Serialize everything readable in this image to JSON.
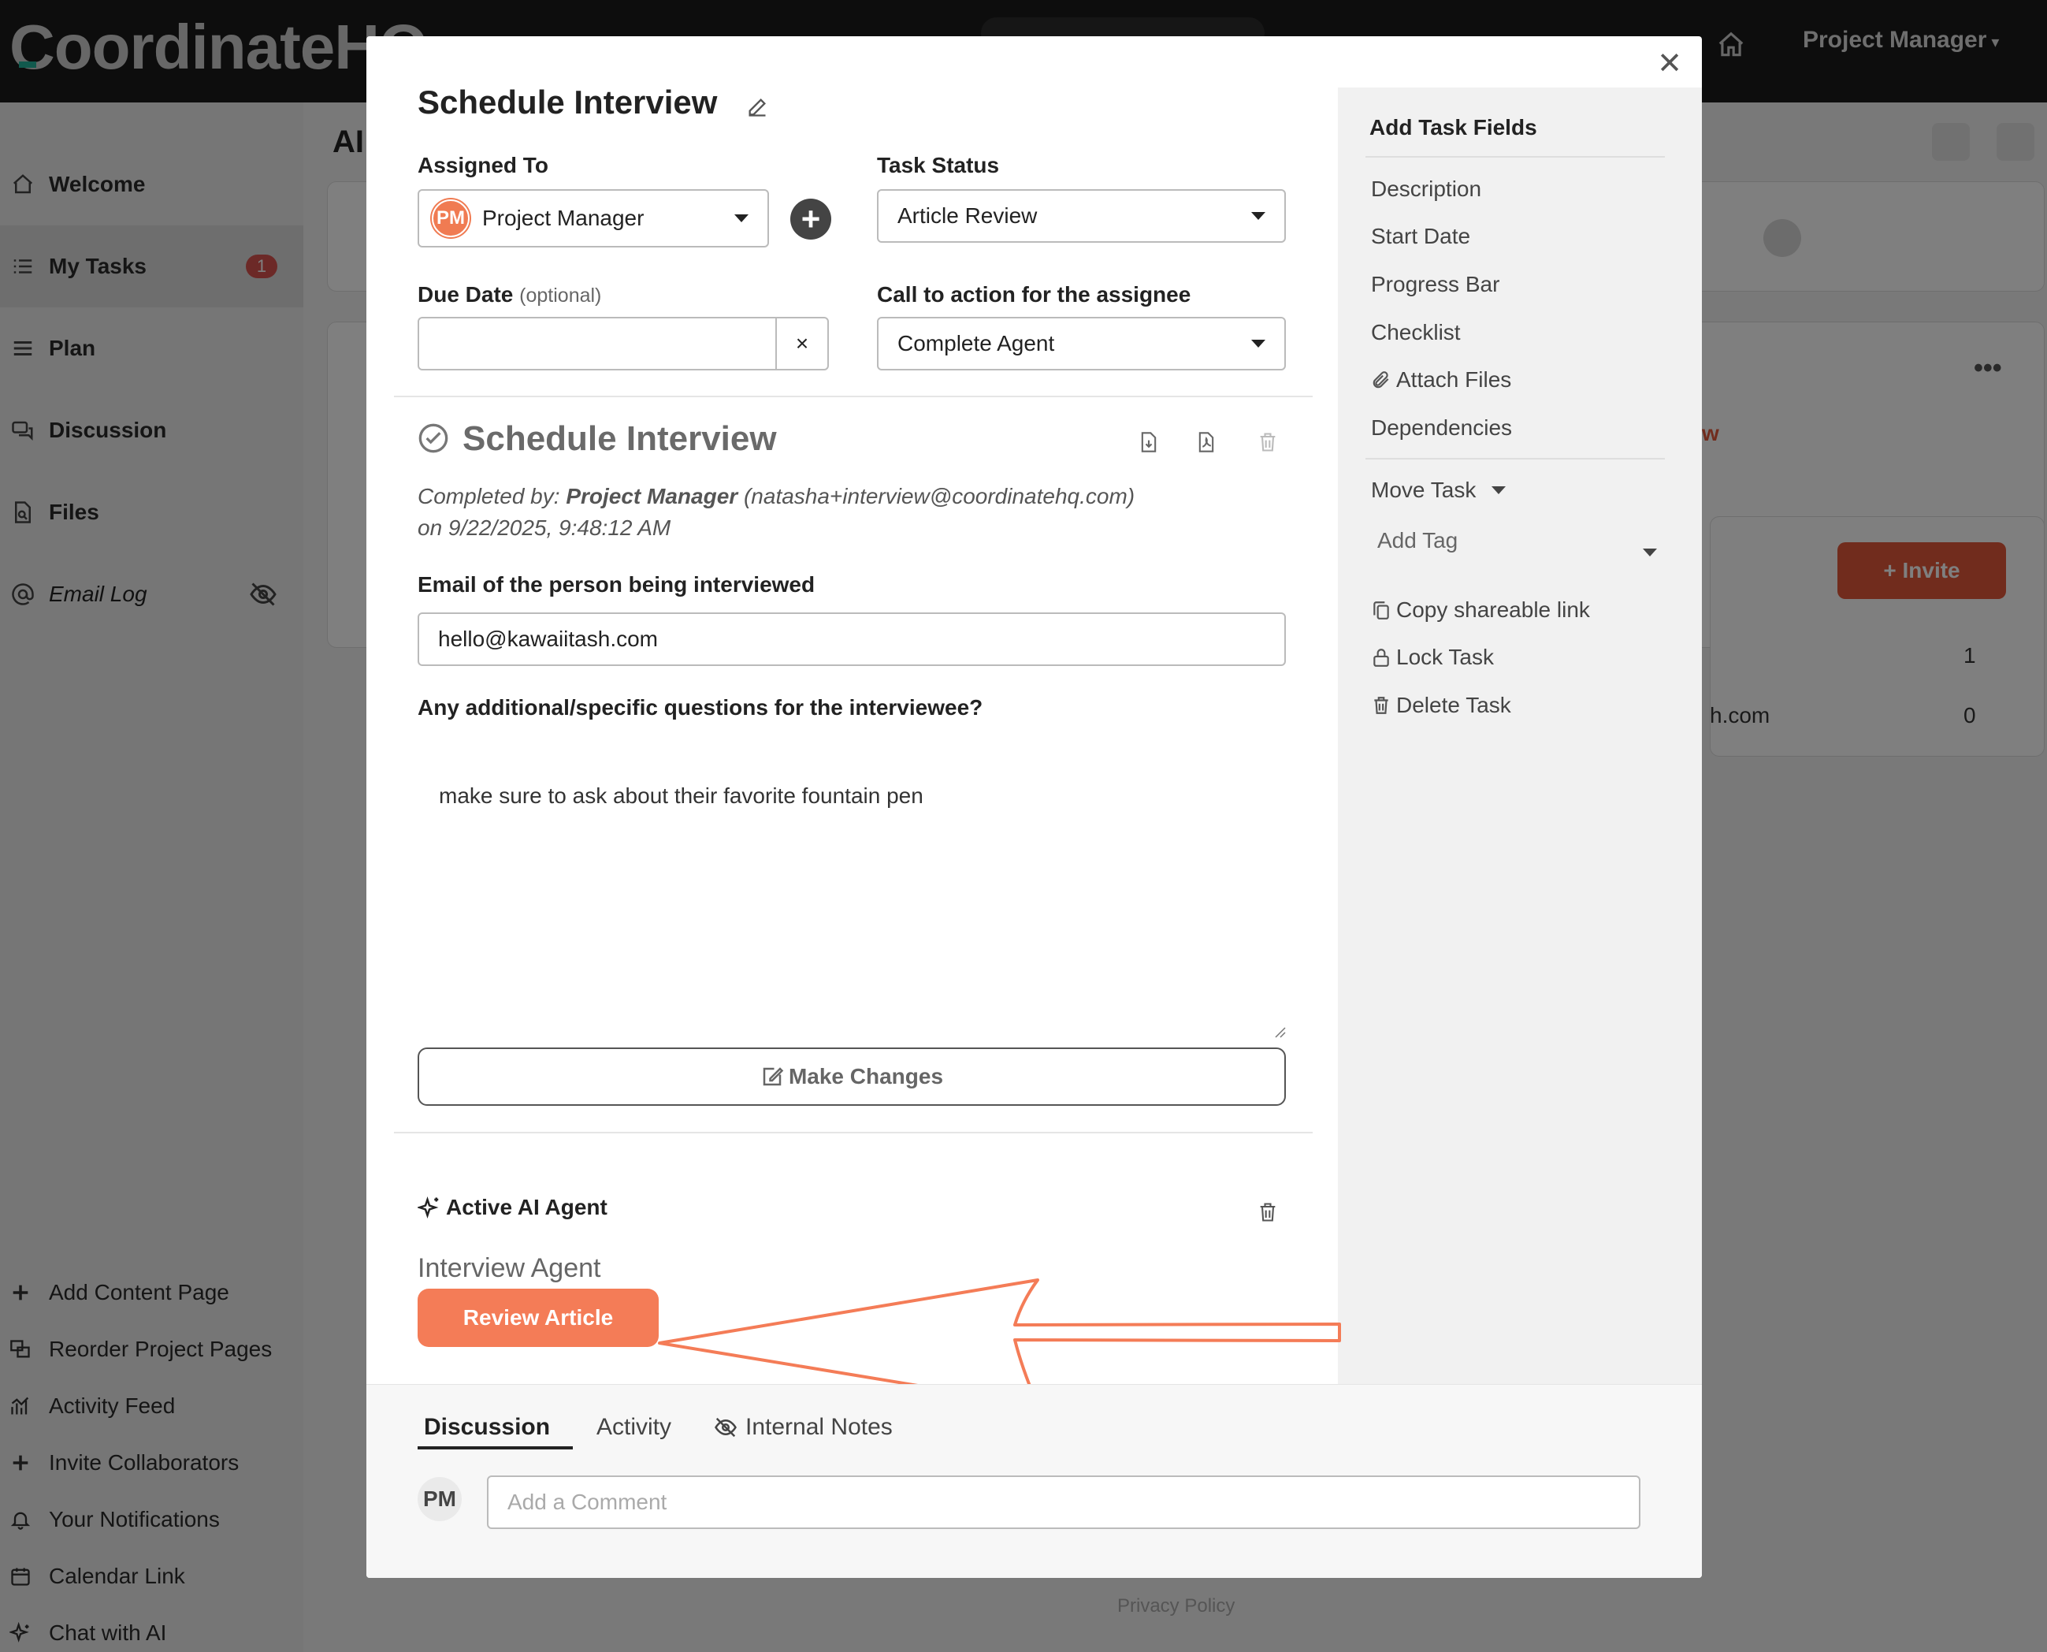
{
  "app": {
    "logo": "CoordinateHQ",
    "user_menu": "Project Manager",
    "main_title_fragment": "AI"
  },
  "sidebar": {
    "items": [
      {
        "label": "Welcome",
        "icon": "home-icon"
      },
      {
        "label": "My Tasks",
        "icon": "list-icon",
        "badge": "1"
      },
      {
        "label": "Plan",
        "icon": "menu-icon"
      },
      {
        "label": "Discussion",
        "icon": "chat-icon"
      },
      {
        "label": "Files",
        "icon": "file-search-icon"
      },
      {
        "label": "Email Log",
        "icon": "at-icon"
      }
    ],
    "bottom_items": [
      {
        "label": "Add Content Page",
        "icon": "plus-icon"
      },
      {
        "label": "Reorder Project Pages",
        "icon": "pages-icon"
      },
      {
        "label": "Activity Feed",
        "icon": "activity-icon"
      },
      {
        "label": "Invite Collaborators",
        "icon": "plus-icon"
      },
      {
        "label": "Your Notifications",
        "icon": "bell-icon"
      },
      {
        "label": "Calendar Link",
        "icon": "calendar-icon"
      },
      {
        "label": "Chat with AI",
        "icon": "sparkle-icon"
      }
    ]
  },
  "background": {
    "fragment_w": "w",
    "fragment_hcom": "h.com",
    "invite_label": "+ Invite",
    "count_1": "1",
    "count_0": "0",
    "privacy": "Privacy Policy"
  },
  "modal": {
    "title": "Schedule Interview",
    "assigned_to_label": "Assigned To",
    "assignee_initials": "PM",
    "assignee_name": "Project Manager",
    "task_status_label": "Task Status",
    "task_status_value": "Article Review",
    "due_date_label": "Due Date",
    "due_date_optional": "(optional)",
    "due_date_value": "",
    "clear_symbol": "×",
    "cta_label": "Call to action for the assignee",
    "cta_value": "Complete Agent",
    "task_name": "Schedule Interview",
    "completed_by_prefix": "Completed by:",
    "completed_by_name": "Project Manager",
    "completed_by_email": "(natasha+interview@coordinatehq.com)",
    "completed_on": "on 9/22/2025, 9:48:12 AM",
    "email_label": "Email of the person being interviewed",
    "email_value": "hello@kawaiitash.com",
    "questions_label": "Any additional/specific questions for the interviewee?",
    "questions_value": "make sure to ask about their favorite fountain pen",
    "make_changes": "Make Changes",
    "ai_section": "Active AI Agent",
    "ai_agent_name": "Interview Agent",
    "review_button": "Review Article"
  },
  "right_panel": {
    "heading": "Add Task Fields",
    "fields": [
      "Description",
      "Start Date",
      "Progress Bar",
      "Checklist",
      "Attach Files",
      "Dependencies"
    ],
    "move_task": "Move Task",
    "add_tag": "Add Tag",
    "actions": [
      "Copy shareable link",
      "Lock Task",
      "Delete Task"
    ]
  },
  "lower": {
    "tabs": [
      "Discussion",
      "Activity",
      "Internal Notes"
    ],
    "active_tab": "Discussion",
    "commenter_initials": "PM",
    "comment_placeholder": "Add a Comment"
  },
  "colors": {
    "accent": "#f47c57",
    "invite": "#e2583a",
    "badge": "#d9534f",
    "topbar": "#1b1b1b"
  }
}
